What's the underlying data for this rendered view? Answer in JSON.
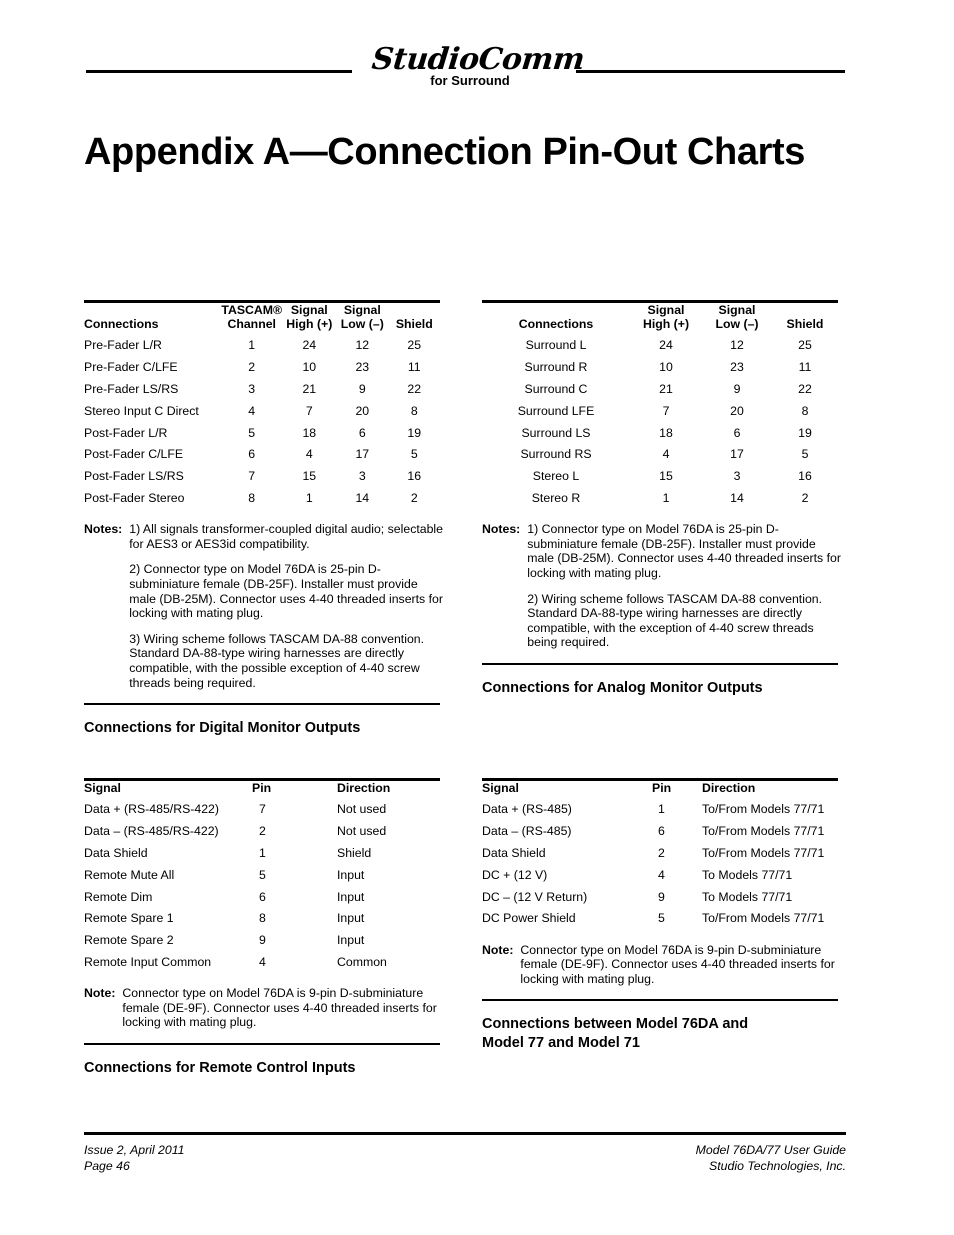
{
  "masthead": {
    "logo_word": "StudioComm",
    "logo_sub": "for Surround"
  },
  "title": "Appendix A—Connection Pin-Out Charts",
  "footer": {
    "left_line1": "Issue 2, April 2011",
    "left_line2": "Page 46",
    "right_line1": "Model 76DA/77 User Guide",
    "right_line2": "Studio Technologies, Inc."
  },
  "tables": {
    "digital_monitor": {
      "headers": [
        "Connections",
        "TASCAM® Channel",
        "Signal High (+)",
        "Signal Low (–)",
        "Shield"
      ],
      "headers_split": [
        [
          "",
          "Connections"
        ],
        [
          "TASCAM®",
          "Channel"
        ],
        [
          "Signal",
          "High (+)"
        ],
        [
          "Signal",
          "Low (–)"
        ],
        [
          "",
          "Shield"
        ]
      ],
      "rows": [
        [
          "Pre-Fader L/R",
          "1",
          "24",
          "12",
          "25"
        ],
        [
          "Pre-Fader C/LFE",
          "2",
          "10",
          "23",
          "11"
        ],
        [
          "Pre-Fader LS/RS",
          "3",
          "21",
          "9",
          "22"
        ],
        [
          "Stereo Input C Direct",
          "4",
          "7",
          "20",
          "8"
        ],
        [
          "Post-Fader L/R",
          "5",
          "18",
          "6",
          "19"
        ],
        [
          "Post-Fader C/LFE",
          "6",
          "4",
          "17",
          "5"
        ],
        [
          "Post-Fader LS/RS",
          "7",
          "15",
          "3",
          "16"
        ],
        [
          "Post-Fader Stereo",
          "8",
          "1",
          "14",
          "2"
        ]
      ],
      "notes_label": "Notes:",
      "notes": [
        "1) All signals transformer-coupled digital audio; selectable for AES3 or AES3id compatibility.",
        "2) Connector type on Model 76DA is 25-pin D-subminiature female (DB-25F). Installer must provide male (DB-25M). Connector uses 4-40 threaded inserts for locking with mating plug.",
        "3) Wiring scheme follows TASCAM DA-88 convention. Standard DA-88-type wiring harnesses are directly compatible, with the possible exception of 4-40 screw threads being required."
      ],
      "heading": "Connections for Digital Monitor Outputs"
    },
    "analog_monitor": {
      "headers_split": [
        [
          "",
          "Connections"
        ],
        [
          "Signal",
          "High (+)"
        ],
        [
          "Signal",
          "Low (–)"
        ],
        [
          "",
          "Shield"
        ]
      ],
      "rows": [
        [
          "Surround L",
          "24",
          "12",
          "25"
        ],
        [
          "Surround R",
          "10",
          "23",
          "11"
        ],
        [
          "Surround C",
          "21",
          "9",
          "22"
        ],
        [
          "Surround LFE",
          "7",
          "20",
          "8"
        ],
        [
          "Surround LS",
          "18",
          "6",
          "19"
        ],
        [
          "Surround RS",
          "4",
          "17",
          "5"
        ],
        [
          "Stereo L",
          "15",
          "3",
          "16"
        ],
        [
          "Stereo R",
          "1",
          "14",
          "2"
        ]
      ],
      "notes_label": "Notes:",
      "notes": [
        "1) Connector type on Model 76DA is 25-pin D-subminiature female (DB-25F). Installer must provide male (DB-25M). Connector uses 4-40 threaded inserts for locking with mating plug.",
        "2) Wiring scheme follows TASCAM DA-88 convention. Standard DA-88-type wiring harnesses are directly compatible, with the exception of 4-40 screw threads being required."
      ],
      "heading": "Connections for Analog Monitor Outputs"
    },
    "remote_control": {
      "headers": [
        "Signal",
        "Pin",
        "Direction"
      ],
      "rows": [
        [
          "Data +  (RS-485/RS-422)",
          "7",
          "Not used"
        ],
        [
          "Data –  (RS-485/RS-422)",
          "2",
          "Not used"
        ],
        [
          "Data Shield",
          "1",
          "Shield"
        ],
        [
          "Remote Mute All",
          "5",
          "Input"
        ],
        [
          "Remote Dim",
          "6",
          "Input"
        ],
        [
          "Remote Spare 1",
          "8",
          "Input"
        ],
        [
          "Remote Spare 2",
          "9",
          "Input"
        ],
        [
          "Remote Input Common",
          "4",
          "Common"
        ]
      ],
      "notes_label": "Note:",
      "notes": [
        "Connector type on Model 76DA is 9-pin D-subminiature female (DE-9F). Connector uses 4-40 threaded inserts for locking with mating plug."
      ],
      "heading": "Connections for Remote Control Inputs"
    },
    "model_77_71": {
      "headers": [
        "Signal",
        "Pin",
        "Direction"
      ],
      "rows": [
        [
          "Data +  (RS-485)",
          "1",
          "To/From Models 77/71"
        ],
        [
          "Data –  (RS-485)",
          "6",
          "To/From Models 77/71"
        ],
        [
          "Data Shield",
          "2",
          "To/From Models 77/71"
        ],
        [
          "DC +  (12 V)",
          "4",
          "To Models 77/71"
        ],
        [
          "DC –  (12 V Return)",
          "9",
          "To Models 77/71"
        ],
        [
          "DC Power Shield",
          "5",
          "To/From Models 77/71"
        ]
      ],
      "notes_label": "Note:",
      "notes": [
        "Connector type on Model 76DA is 9-pin D-subminiature female (DE-9F). Connector uses 4-40 threaded inserts for locking with mating plug."
      ],
      "heading": "Connections between Model 76DA and Model 77 and Model 71"
    }
  }
}
